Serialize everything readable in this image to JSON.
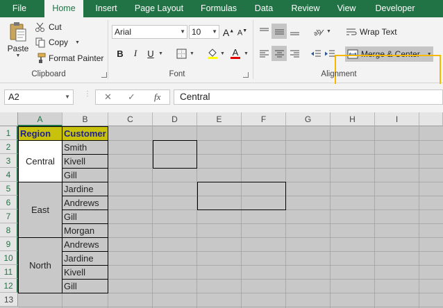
{
  "tabs": [
    {
      "label": "File",
      "active": false
    },
    {
      "label": "Home",
      "active": true
    },
    {
      "label": "Insert",
      "active": false
    },
    {
      "label": "Page Layout",
      "active": false
    },
    {
      "label": "Formulas",
      "active": false
    },
    {
      "label": "Data",
      "active": false
    },
    {
      "label": "Review",
      "active": false
    },
    {
      "label": "View",
      "active": false
    },
    {
      "label": "Developer",
      "active": false
    }
  ],
  "clipboard": {
    "paste_label": "Paste",
    "cut_label": "Cut",
    "copy_label": "Copy",
    "format_painter_label": "Format Painter",
    "group_label": "Clipboard"
  },
  "font": {
    "name": "Arial",
    "size": "10",
    "group_label": "Font",
    "grow_glyph": "A",
    "shrink_glyph": "A",
    "bold_glyph": "B",
    "italic_glyph": "I",
    "underline_glyph": "U",
    "font_color_glyph": "A"
  },
  "alignment": {
    "wrap_text_label": "Wrap Text",
    "merge_center_label": "Merge & Center",
    "group_label": "Alignment",
    "highlight_color": "#f5b800"
  },
  "formula_bar": {
    "name_box": "A2",
    "cancel_glyph": "✕",
    "enter_glyph": "✓",
    "fx_glyph": "fx",
    "formula": "Central"
  },
  "sheet": {
    "columns": [
      "A",
      "B",
      "C",
      "D",
      "E",
      "F",
      "G",
      "H",
      "I"
    ],
    "rows": [
      "1",
      "2",
      "3",
      "4",
      "5",
      "6",
      "7",
      "8",
      "9",
      "10",
      "11",
      "12",
      "13"
    ],
    "selected_column": "A",
    "selected_rows": [
      "1",
      "2",
      "3",
      "4",
      "5",
      "6",
      "7",
      "8",
      "9",
      "10",
      "11",
      "12"
    ],
    "header_fill": "#c9c20c",
    "header_text_color": "#1f1f8f",
    "headers": {
      "region": "Region",
      "customer": "Customer"
    },
    "regions": [
      "Central",
      "East",
      "North"
    ],
    "customers": [
      "Smith",
      "Kivell",
      "Gill",
      "Jardine",
      "Andrews",
      "Gill",
      "Morgan",
      "Andrews",
      "Jardine",
      "Kivell",
      "Gill"
    ]
  }
}
